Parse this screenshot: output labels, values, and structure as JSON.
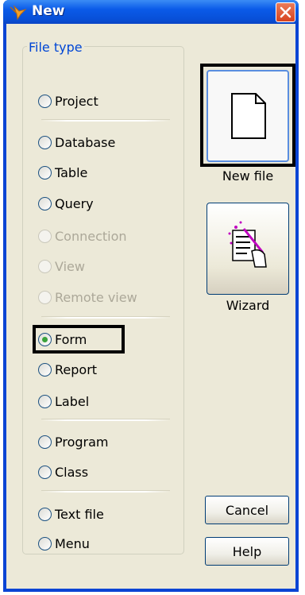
{
  "window": {
    "title": "New"
  },
  "file_type": {
    "group_label": "File type",
    "options": [
      {
        "label": "Project",
        "enabled": true,
        "checked": false
      },
      {
        "label": "Database",
        "enabled": true,
        "checked": false
      },
      {
        "label": "Table",
        "enabled": true,
        "checked": false
      },
      {
        "label": "Query",
        "enabled": true,
        "checked": false
      },
      {
        "label": "Connection",
        "enabled": false,
        "checked": false
      },
      {
        "label": "View",
        "enabled": false,
        "checked": false
      },
      {
        "label": "Remote view",
        "enabled": false,
        "checked": false
      },
      {
        "label": "Form",
        "enabled": true,
        "checked": true
      },
      {
        "label": "Report",
        "enabled": true,
        "checked": false
      },
      {
        "label": "Label",
        "enabled": true,
        "checked": false
      },
      {
        "label": "Program",
        "enabled": true,
        "checked": false
      },
      {
        "label": "Class",
        "enabled": true,
        "checked": false
      },
      {
        "label": "Text file",
        "enabled": true,
        "checked": false
      },
      {
        "label": "Menu",
        "enabled": true,
        "checked": false
      }
    ]
  },
  "actions": {
    "new_file_label": "New file",
    "wizard_label": "Wizard",
    "cancel_label": "Cancel",
    "help_label": "Help"
  },
  "colors": {
    "titlebar": "#0a5ae8",
    "dialog_bg": "#ece9d8",
    "group_label": "#0046d5",
    "highlight_frame": "#000000"
  }
}
